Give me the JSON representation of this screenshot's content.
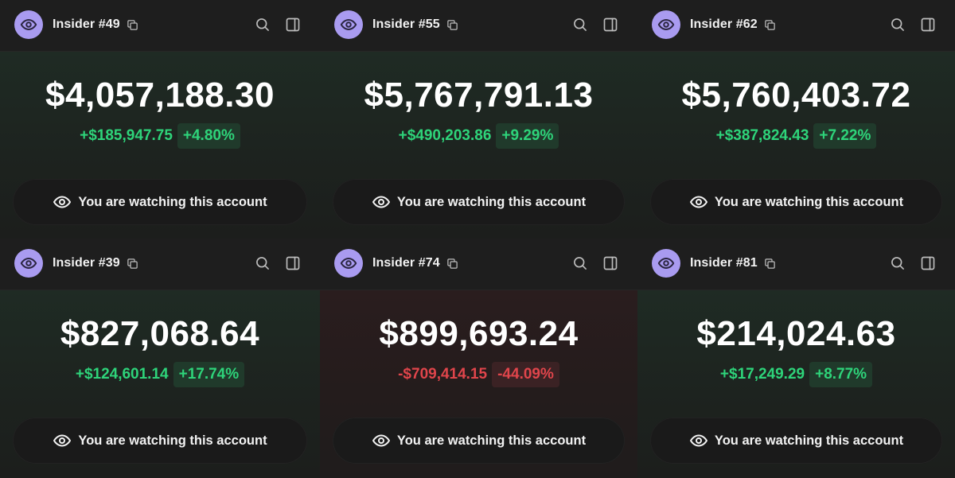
{
  "accounts": [
    {
      "name": "Insider #49",
      "balance": "$4,057,188.30",
      "change_amount": "+$185,947.75",
      "change_pct": "+4.80%",
      "trend": "gain",
      "watch_label": "You are watching this account"
    },
    {
      "name": "Insider #55",
      "balance": "$5,767,791.13",
      "change_amount": "+$490,203.86",
      "change_pct": "+9.29%",
      "trend": "gain",
      "watch_label": "You are watching this account"
    },
    {
      "name": "Insider #62",
      "balance": "$5,760,403.72",
      "change_amount": "+$387,824.43",
      "change_pct": "+7.22%",
      "trend": "gain",
      "watch_label": "You are watching this account"
    },
    {
      "name": "Insider #39",
      "balance": "$827,068.64",
      "change_amount": "+$124,601.14",
      "change_pct": "+17.74%",
      "trend": "gain",
      "watch_label": "You are watching this account"
    },
    {
      "name": "Insider #74",
      "balance": "$899,693.24",
      "change_amount": "-$709,414.15",
      "change_pct": "-44.09%",
      "trend": "loss",
      "watch_label": "You are watching this account"
    },
    {
      "name": "Insider #81",
      "balance": "$214,024.63",
      "change_amount": "+$17,249.29",
      "change_pct": "+8.77%",
      "trend": "gain",
      "watch_label": "You are watching this account"
    }
  ],
  "icons": {
    "avatar": "eye-icon",
    "copy": "copy-icon",
    "search": "search-icon",
    "panel": "sidebar-panel-icon",
    "watch": "eye-icon"
  },
  "colors": {
    "avatar_bg": "#a99bf0",
    "gain": "#2ed47a",
    "loss": "#e0454b"
  }
}
